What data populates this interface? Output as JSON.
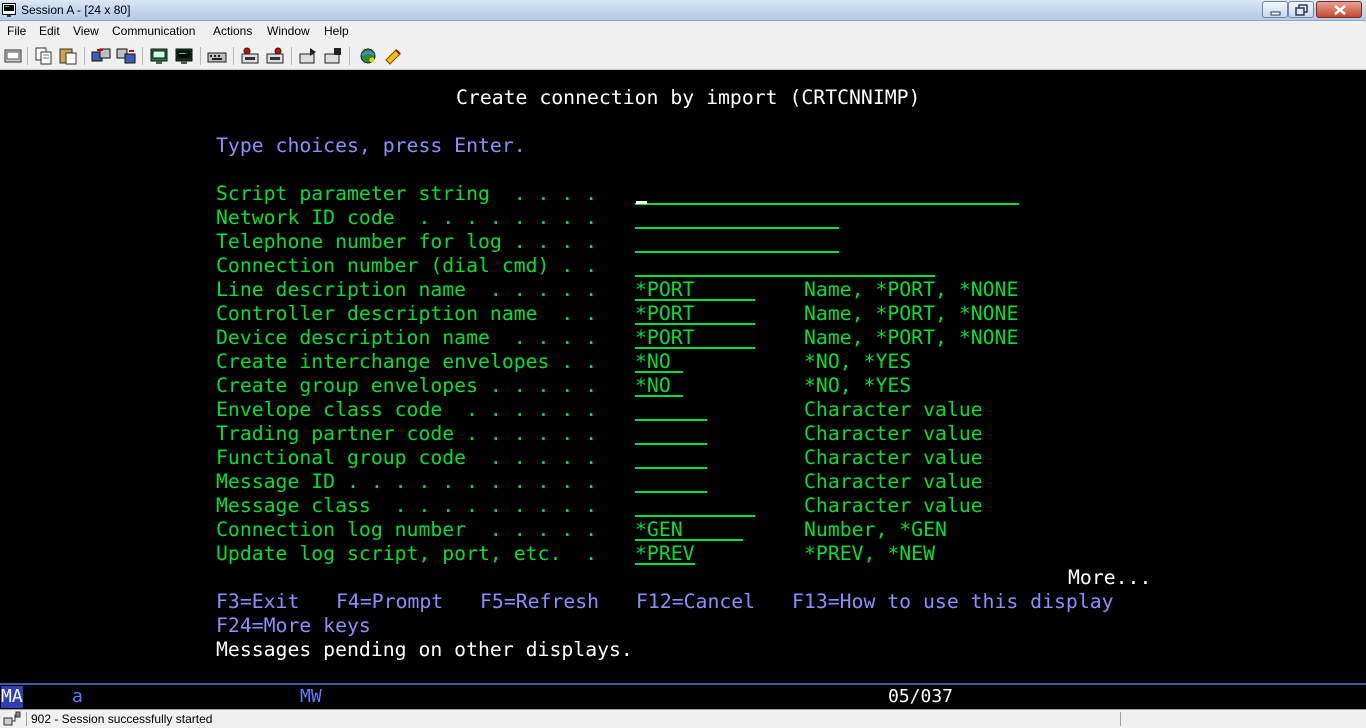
{
  "window": {
    "title": "Session A - [24 x 80]"
  },
  "menu": [
    "File",
    "Edit",
    "View",
    "Communication",
    "Actions",
    "Window",
    "Help"
  ],
  "toolbar_icons": [
    "print-screen-icon",
    "copy-icon",
    "paste-icon",
    "send-icon",
    "receive-icon",
    "display-icon",
    "keyboard-icon",
    "record-macro-icon",
    "play-macro-icon",
    "run-icon",
    "stop-icon",
    "connect-icon",
    "disconnect-icon",
    "globe-icon",
    "help-icon"
  ],
  "screen": {
    "title": "Create connection by import (CRTCNNIMP)",
    "instructions": "Type choices, press Enter.",
    "params": [
      {
        "label": "Script parameter string  . . . .",
        "value": "",
        "hint": ""
      },
      {
        "label": "Network ID code  . . . . . . . .",
        "value": "",
        "hint": ""
      },
      {
        "label": "Telephone number for log . . . .",
        "value": "",
        "hint": ""
      },
      {
        "label": "Connection number (dial cmd) . .",
        "value": "",
        "hint": ""
      },
      {
        "label": "Line description name  . . . . .",
        "value": "*PORT",
        "hint": "Name, *PORT, *NONE"
      },
      {
        "label": "Controller description name  . .",
        "value": "*PORT",
        "hint": "Name, *PORT, *NONE"
      },
      {
        "label": "Device description name  . . . .",
        "value": "*PORT",
        "hint": "Name, *PORT, *NONE"
      },
      {
        "label": "Create interchange envelopes . .",
        "value": "*NO",
        "hint": "*NO, *YES"
      },
      {
        "label": "Create group envelopes . . . . .",
        "value": "*NO",
        "hint": "*NO, *YES"
      },
      {
        "label": "Envelope class code  . . . . . .",
        "value": "",
        "hint": "Character value"
      },
      {
        "label": "Trading partner code . . . . . .",
        "value": "",
        "hint": "Character value"
      },
      {
        "label": "Functional group code  . . . . .",
        "value": "",
        "hint": "Character value"
      },
      {
        "label": "Message ID . . . . . . . . . . .",
        "value": "",
        "hint": "Character value"
      },
      {
        "label": "Message class  . . . . . . . . .",
        "value": "",
        "hint": "Character value"
      },
      {
        "label": "Connection log number  . . . . .",
        "value": "*GEN",
        "hint": "Number, *GEN"
      },
      {
        "label": "Update log script, port, etc.  .",
        "value": "*PREV",
        "hint": "*PREV, *NEW"
      }
    ],
    "more": "More...",
    "fkeys": [
      {
        "label": "F3=Exit"
      },
      {
        "label": "F4=Prompt"
      },
      {
        "label": "F5=Refresh"
      },
      {
        "label": "F12=Cancel"
      },
      {
        "label": "F13=How to use this display"
      },
      {
        "label": "F24=More keys"
      }
    ],
    "message": "Messages pending on other displays."
  },
  "oia": {
    "ma": "MA",
    "a": "a",
    "mw": "MW",
    "cursor_pos": "05/037"
  },
  "status": {
    "text": "902 - Session successfully started"
  },
  "colors": {
    "green": "#00e030",
    "white": "#ffffff",
    "blue": "#8d8dff",
    "background": "#000000"
  }
}
